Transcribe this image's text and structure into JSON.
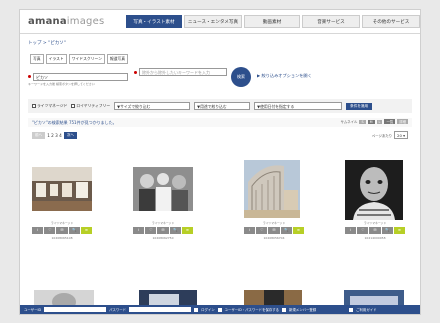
{
  "header": {
    "logo_main": "amana",
    "logo_sub": "images",
    "tabs": [
      {
        "label": "写真・イラスト素材",
        "active": true
      },
      {
        "label": "ニュース・エンタメ写真",
        "active": false
      },
      {
        "label": "動画素材",
        "active": false
      },
      {
        "label": "音楽サービス",
        "active": false
      },
      {
        "label": "その他のサービス",
        "active": false
      }
    ]
  },
  "breadcrumb": "トップ > \"ピカソ\"",
  "filters": [
    "写真",
    "イラスト",
    "ワイドスクリーン",
    "報道写真"
  ],
  "search": {
    "keyword": "ピカソ",
    "keyword_note": "キーワードを入力後 検索ボタンを押してください",
    "exclude_placeholder": "除外から除外したいキーワードを入力",
    "button_label": "検索",
    "options_link": "▶ 絞り込みオプションを開く"
  },
  "options": {
    "check1": "ライツマネージド",
    "check2": "ロイヤリティフリー",
    "size_select": "▼サイズで絞り込む",
    "use_select": "▼用途で絞り込む",
    "date_select": "▼使用日付を指定する",
    "apply_button": "条件を適用"
  },
  "results": {
    "text": "\"ピカソ\"の検索結果 751件が見つかりました。",
    "view_label": "サムネイル",
    "size_s": "S",
    "size_m": "M",
    "size_l": "L",
    "mode1": "一覧",
    "mode2": "詳細"
  },
  "pager": {
    "prev": "前へ",
    "pages": "1 2 3 4",
    "next": "次へ",
    "per_page_label": "ページあたり",
    "per_page_value": "20 ▾"
  },
  "cards": [
    {
      "caption": "ライツマネージド",
      "id": "10208065108",
      "scene": "gallery"
    },
    {
      "caption": "ライツマネージド",
      "id": "10208062750",
      "scene": "crowd"
    },
    {
      "caption": "ライツマネージド",
      "id": "10208056704",
      "scene": "building"
    },
    {
      "caption": "ライツマネージド",
      "id": "10214000058",
      "scene": "portrait"
    }
  ],
  "card_buttons": [
    "i",
    "♡",
    "✉",
    "🔍",
    "≡"
  ],
  "footer": {
    "user_label": "ユーザーID",
    "pass_label": "パスワード",
    "login": "ログイン",
    "remember": "ユーザーID・パスワードを保存する",
    "register": "新規メンバー登録",
    "guide": "ご利用ガイド"
  }
}
